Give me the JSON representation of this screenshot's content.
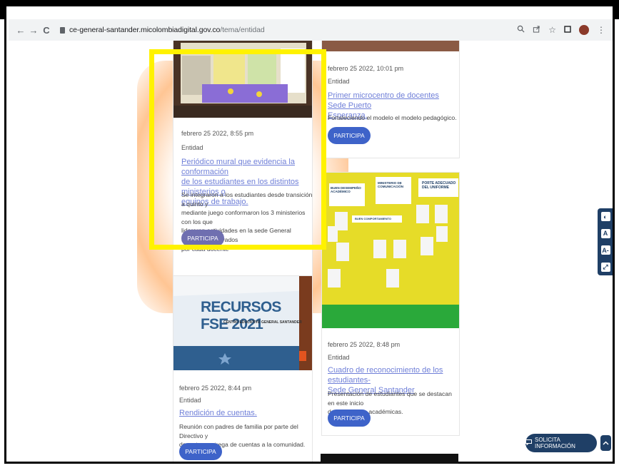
{
  "browser": {
    "url_domain": "ce-general-santander.micolombiadigital.gov.co",
    "url_path": "/tema/entidad",
    "nav_back": "←",
    "nav_forward": "→",
    "nav_reload": "C",
    "icons": [
      "zoom-icon",
      "share-icon",
      "star-icon",
      "tab-icon",
      "profile-avatar",
      "menu-icon"
    ]
  },
  "cards": [
    {
      "date": "febrero 25 2022, 8:55 pm",
      "category": "Entidad",
      "title_lines": [
        "Periódico mural que evidencia la conformación",
        "de los estudiantes en los distintos ministerios o",
        "equipos de trabajo."
      ],
      "desc_lines": [
        "Se integraron a los estudiantes desde transición a quinto y",
        "mediante juego conformaron los 3 ministerios con los que",
        "lideraran actividades en la sede General Santander apoyados",
        "por cada docente"
      ],
      "button": "PARTICIPA"
    },
    {
      "date": "febrero 25 2022, 10:01 pm",
      "category": "Entidad",
      "title_lines": [
        "Primer microcentro de docentes Sede Puerto",
        "Esperanza."
      ],
      "desc_lines": [
        "Fortaleciendo el modelo el modelo pedagógico."
      ],
      "button": "PARTICIPA"
    },
    {
      "image_title": "RECURSOS FSE 2021",
      "image_subtitle": "CENTRO EDUCATIVO GENERAL SANTANDER",
      "date": "febrero 25 2022, 8:44 pm",
      "category": "Entidad",
      "title_lines": [
        "Rendición de cuentas."
      ],
      "desc_lines": [
        "Reunión con padres de familia por parte del Directivo y",
        "docentes, entrega de cuentas a la comunidad."
      ],
      "button": "PARTICIPA"
    },
    {
      "image_signs": [
        "BUEN DESEMPEÑO ACADÉMICO",
        "MINISTERIO DE COMUNICACIÓN",
        "PORTE ADECUADO DEL UNIFORME",
        "BUEN COMPORTAMIENTO"
      ],
      "date": "febrero 25 2022, 8:48 pm",
      "category": "Entidad",
      "title_lines": [
        "Cuadro de reconocimiento de los estudiantes-",
        "Sede General Santander"
      ],
      "desc_lines": [
        "Presentación de estudiantes que se destacan en este inicio",
        "de actividades académicas."
      ],
      "button": "PARTICIPA"
    }
  ],
  "widgets": {
    "solicita_label": "SOLICITA INFORMACIÓN",
    "solicita_icon": "chat-icon",
    "up_icon": "chevron-up-icon",
    "side_tools": [
      "◐",
      "A",
      "A-",
      "⤢"
    ]
  },
  "colors": {
    "accent": "#3e63c9",
    "link": "#6f7fd8",
    "highlight": "#fff200",
    "navy": "#1f3f66"
  }
}
